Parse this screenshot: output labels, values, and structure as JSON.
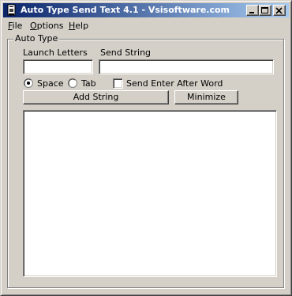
{
  "window": {
    "title": "Auto Type Send Text 4.1 - Vsisoftware.com",
    "titlebar_color_start": "#0a246a",
    "titlebar_color_end": "#a6caf0",
    "face_color": "#d4d0c8",
    "icon": "app-icon",
    "controls": [
      "minimize-icon",
      "maximize-icon",
      "close-icon"
    ]
  },
  "menu": {
    "items": [
      {
        "label": "File"
      },
      {
        "label": "Options"
      },
      {
        "label": "Help"
      }
    ]
  },
  "group": {
    "title": "Auto Type",
    "launch_letters_label": "Launch Letters",
    "launch_letters_value": "",
    "send_string_label": "Send String",
    "send_string_value": "",
    "radio_space_label": "Space",
    "radio_space_selected": true,
    "radio_tab_label": "Tab",
    "radio_tab_selected": false,
    "send_enter_label": "Send Enter After Word",
    "send_enter_checked": false,
    "add_string_label": "Add String",
    "minimize_label": "Minimize",
    "list_items": []
  }
}
